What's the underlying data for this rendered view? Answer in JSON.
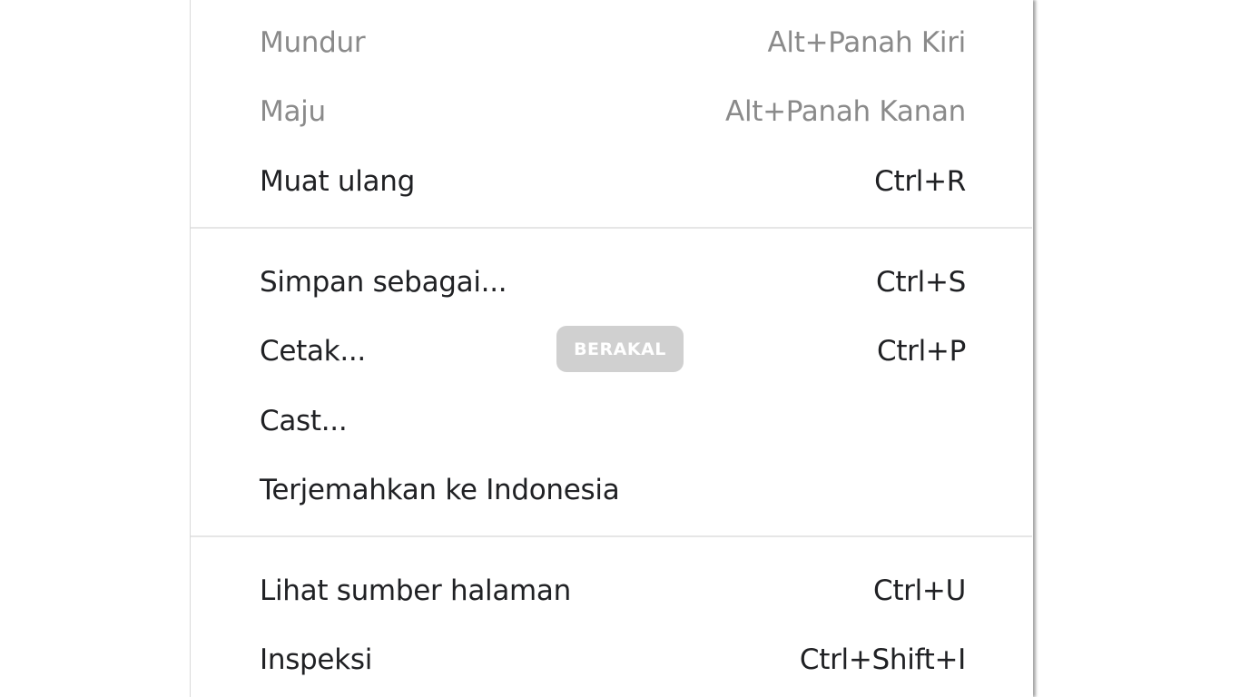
{
  "menu": {
    "items": [
      {
        "label": "Mundur",
        "shortcut": "Alt+Panah Kiri",
        "disabled": true
      },
      {
        "label": "Maju",
        "shortcut": "Alt+Panah Kanan",
        "disabled": true
      },
      {
        "label": "Muat ulang",
        "shortcut": "Ctrl+R",
        "disabled": false
      },
      {
        "label": "Simpan sebagai...",
        "shortcut": "Ctrl+S",
        "disabled": false
      },
      {
        "label": "Cetak...",
        "shortcut": "Ctrl+P",
        "disabled": false
      },
      {
        "label": "Cast...",
        "shortcut": "",
        "disabled": false
      },
      {
        "label": "Terjemahkan ke Indonesia",
        "shortcut": "",
        "disabled": false
      },
      {
        "label": "Lihat sumber halaman",
        "shortcut": "Ctrl+U",
        "disabled": false
      },
      {
        "label": "Inspeksi",
        "shortcut": "Ctrl+Shift+I",
        "disabled": false
      }
    ]
  },
  "watermark": {
    "text": "BERAKAL"
  },
  "colors": {
    "text": "#202124",
    "disabled_text": "#8a8a8a",
    "separator": "#e6e6e6"
  }
}
